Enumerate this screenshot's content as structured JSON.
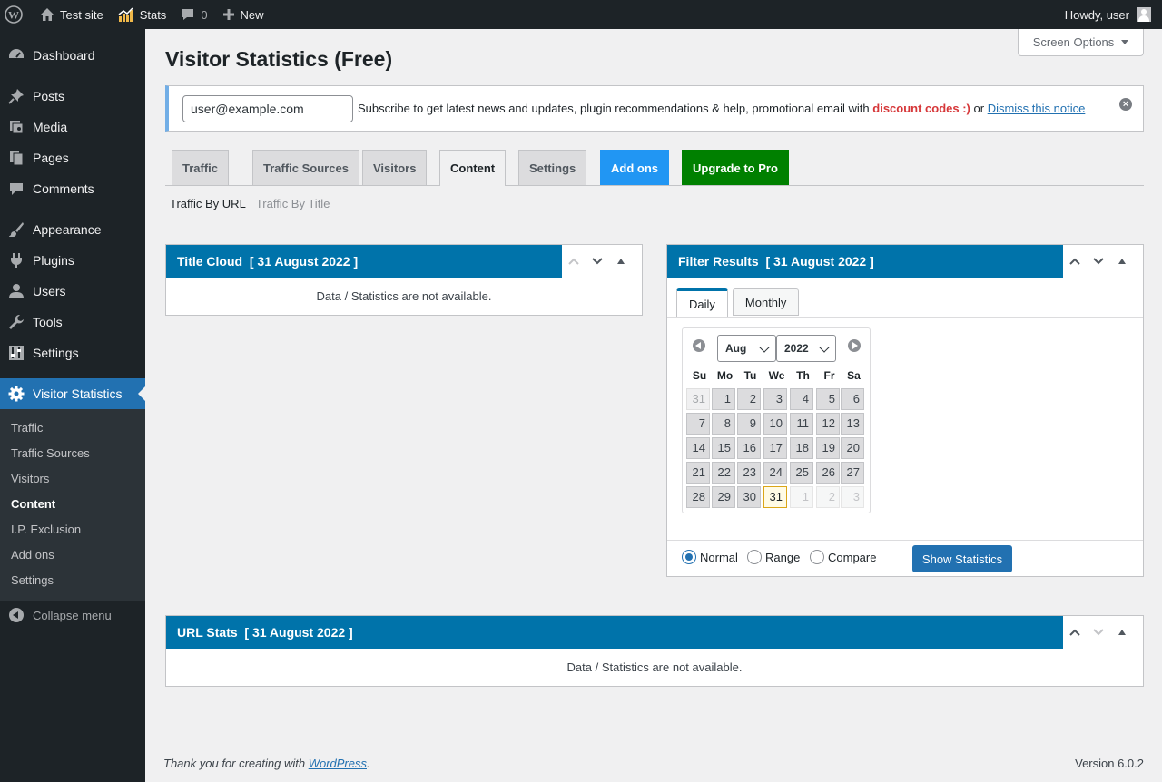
{
  "adminbar": {
    "site_name": "Test site",
    "stats_label": "Stats",
    "comments_count": "0",
    "new_label": "New",
    "howdy": "Howdy, user"
  },
  "sidebar": {
    "items": [
      {
        "label": "Dashboard",
        "icon": "dashboard-icon"
      },
      {
        "label": "Posts",
        "icon": "pin-icon"
      },
      {
        "label": "Media",
        "icon": "media-icon"
      },
      {
        "label": "Pages",
        "icon": "pages-icon"
      },
      {
        "label": "Comments",
        "icon": "comment-icon"
      },
      {
        "label": "Appearance",
        "icon": "brush-icon"
      },
      {
        "label": "Plugins",
        "icon": "plug-icon"
      },
      {
        "label": "Users",
        "icon": "user-icon"
      },
      {
        "label": "Tools",
        "icon": "wrench-icon"
      },
      {
        "label": "Settings",
        "icon": "settings-icon"
      },
      {
        "label": "Visitor Statistics",
        "icon": "gear-icon"
      }
    ],
    "submenu": [
      "Traffic",
      "Traffic Sources",
      "Visitors",
      "Content",
      "I.P. Exclusion",
      "Add ons",
      "Settings"
    ],
    "collapse_label": "Collapse menu"
  },
  "screen_options": "Screen Options",
  "page_title": "Visitor Statistics (Free)",
  "notice": {
    "email_value": "user@example.com",
    "text_before": "Subscribe to get latest news and updates, plugin recommendations & help, promotional email with ",
    "discount": "discount codes :)",
    "text_or": " or ",
    "dismiss": "Dismiss this notice"
  },
  "tabs": [
    "Traffic",
    "Traffic Sources",
    "Visitors",
    "Content",
    "Settings",
    "Add ons",
    "Upgrade to Pro"
  ],
  "subtabs": {
    "active": "Traffic By URL",
    "link": "Traffic By Title"
  },
  "title_cloud": {
    "title": "Title Cloud  [ 31 August 2022 ]",
    "empty": "Data / Statistics are not available."
  },
  "filter": {
    "title": "Filter Results  [ 31 August 2022 ]",
    "tab_daily": "Daily",
    "tab_monthly": "Monthly",
    "month": "Aug",
    "year": "2022",
    "dow": [
      "Su",
      "Mo",
      "Tu",
      "We",
      "Th",
      "Fr",
      "Sa"
    ],
    "weeks": [
      [
        "31",
        "1",
        "2",
        "3",
        "4",
        "5",
        "6"
      ],
      [
        "7",
        "8",
        "9",
        "10",
        "11",
        "12",
        "13"
      ],
      [
        "14",
        "15",
        "16",
        "17",
        "18",
        "19",
        "20"
      ],
      [
        "21",
        "22",
        "23",
        "24",
        "25",
        "26",
        "27"
      ],
      [
        "28",
        "29",
        "30",
        "31",
        "1",
        "2",
        "3"
      ]
    ],
    "radio_normal": "Normal",
    "radio_range": "Range",
    "radio_compare": "Compare",
    "show_btn": "Show Statistics"
  },
  "url_stats": {
    "title": "URL Stats  [ 31 August 2022 ]",
    "empty": "Data / Statistics are not available."
  },
  "footer": {
    "thanks": "Thank you for creating with ",
    "wp": "WordPress",
    "period": ".",
    "version": "Version 6.0.2"
  },
  "colors": {
    "accent": "#2271b1",
    "panel_header": "#0073aa",
    "addons": "#2196f3",
    "pro": "#008000",
    "discount": "#d63638"
  }
}
